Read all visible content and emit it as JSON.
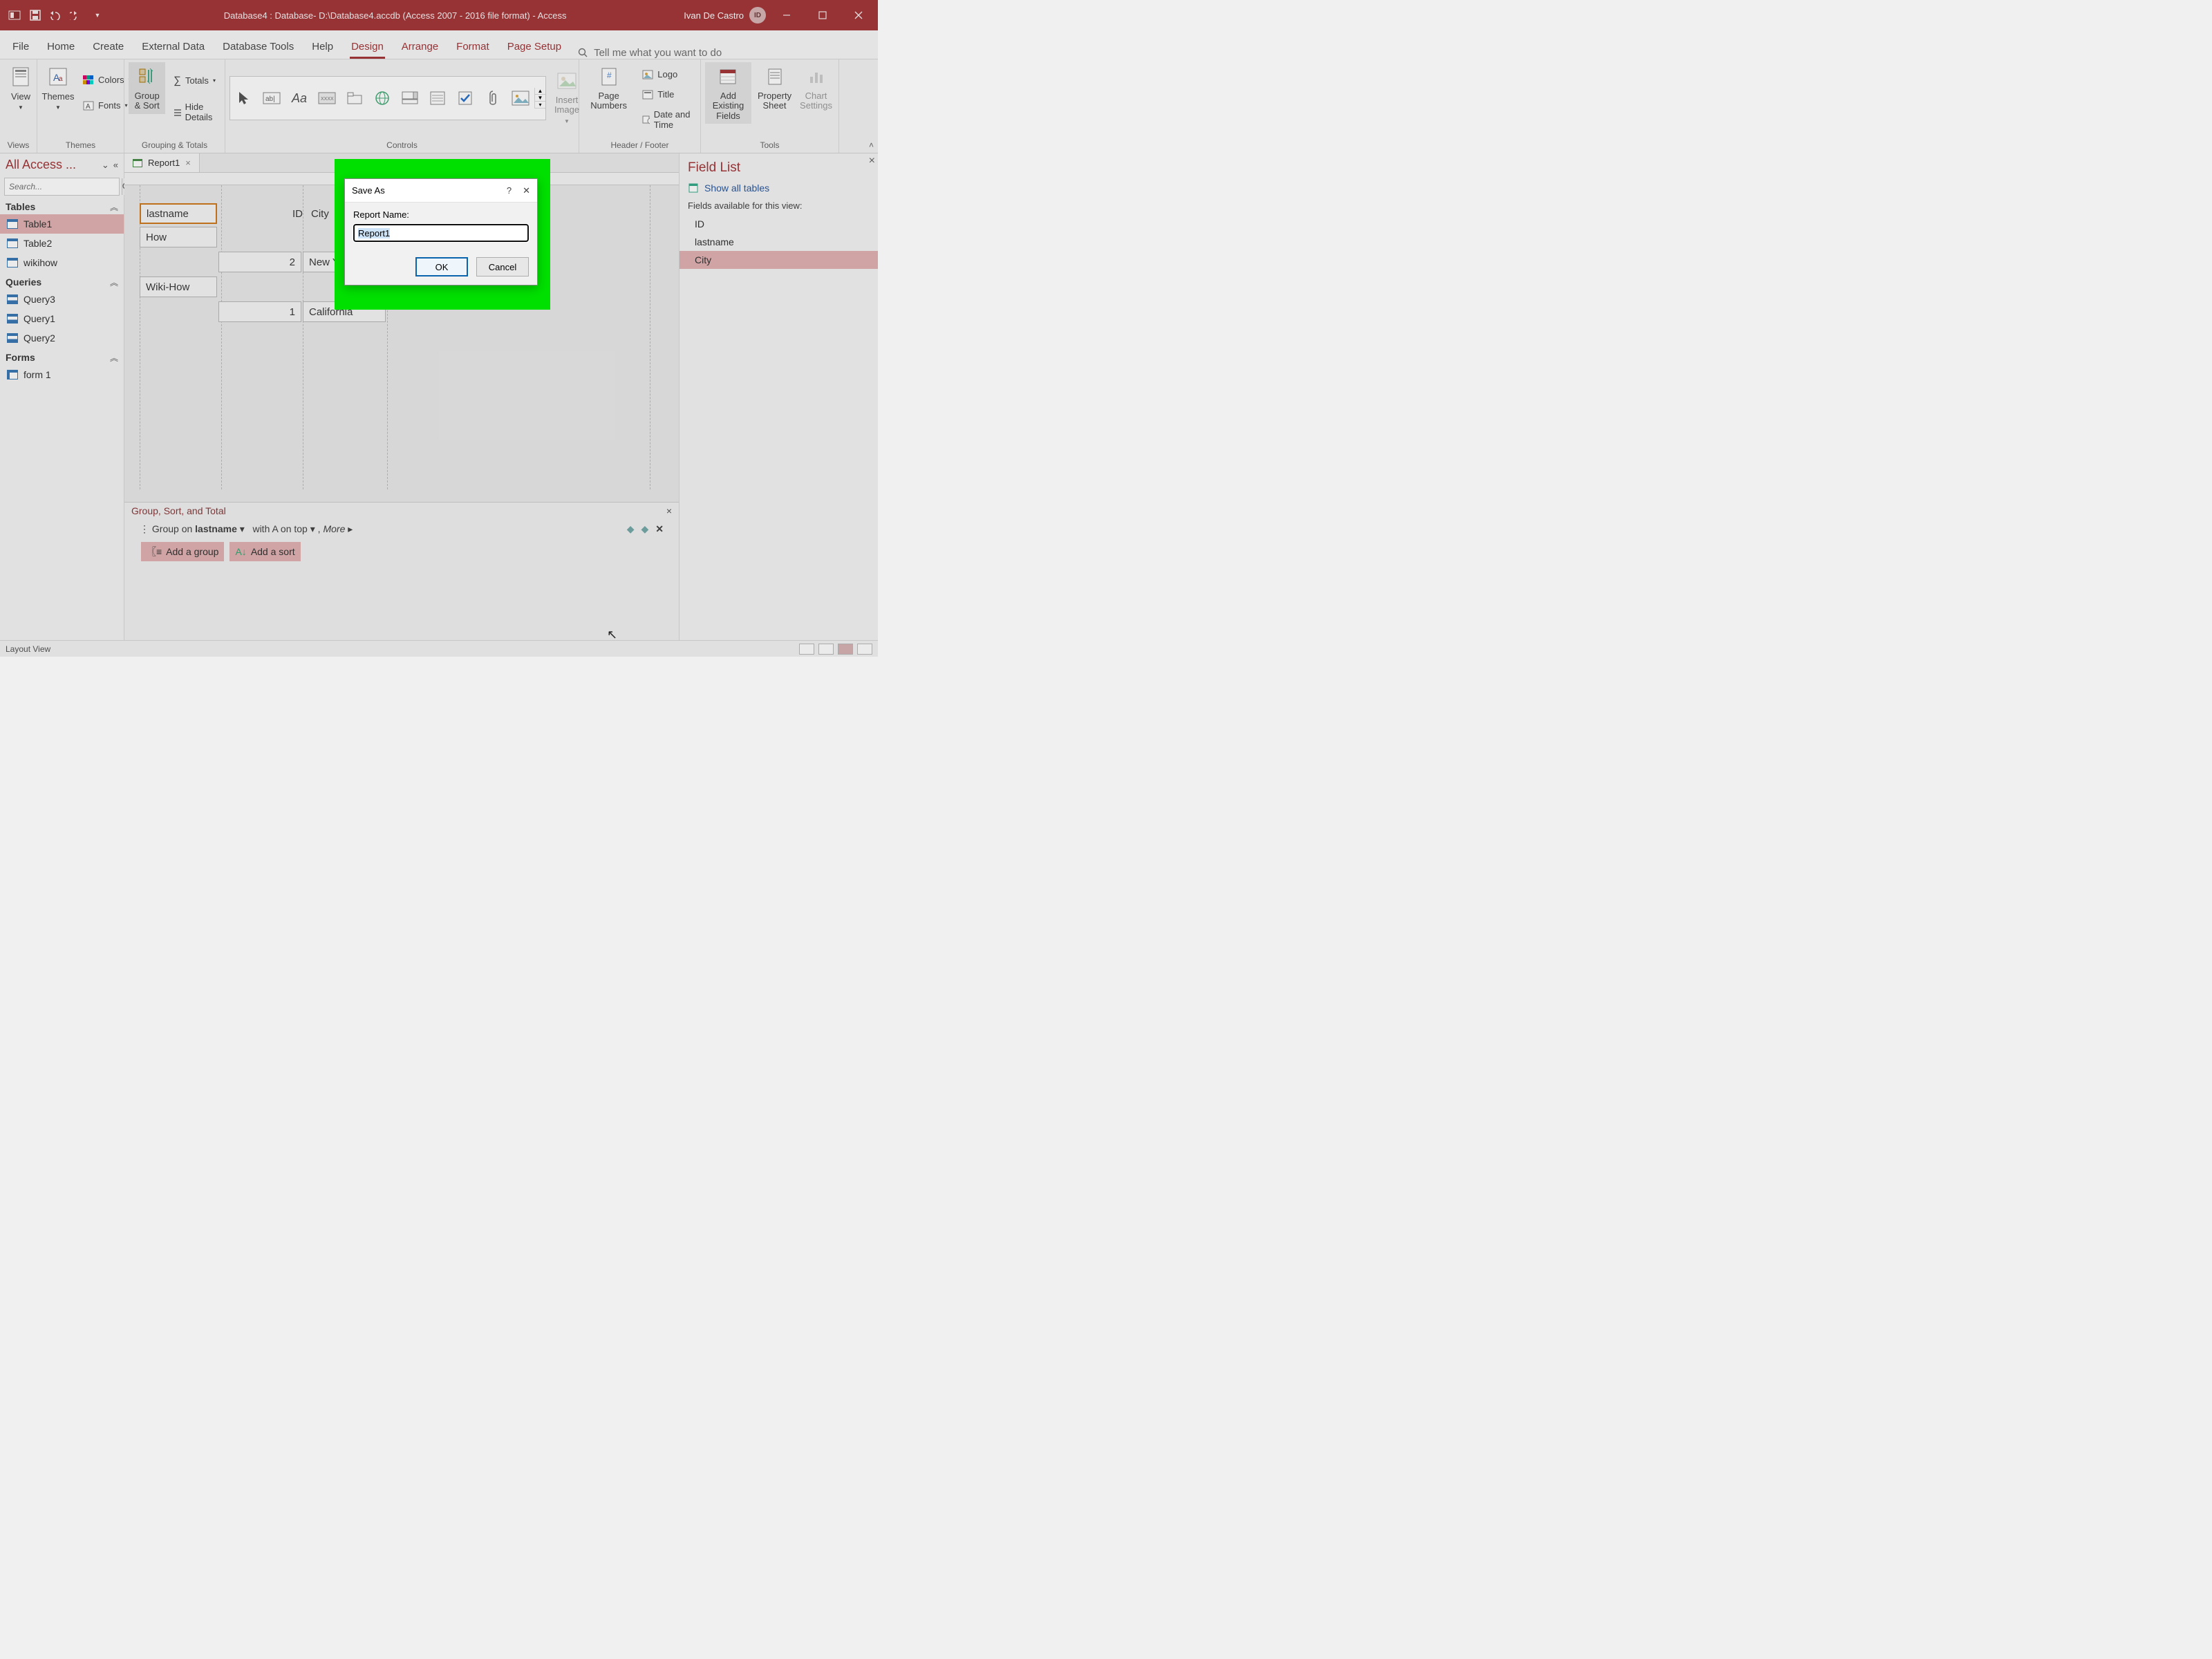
{
  "titlebar": {
    "title": "Database4 : Database- D:\\Database4.accdb (Access 2007 - 2016 file format) -  Access",
    "user_name": "Ivan De Castro",
    "user_initials": "ID"
  },
  "ribbon_tabs": [
    "File",
    "Home",
    "Create",
    "External Data",
    "Database Tools",
    "Help",
    "Design",
    "Arrange",
    "Format",
    "Page Setup"
  ],
  "ribbon_active_tab": "Design",
  "tellme_placeholder": "Tell me what you want to do",
  "ribbon": {
    "views": {
      "view": "View",
      "group": "Views"
    },
    "themes": {
      "themes": "Themes",
      "colors": "Colors",
      "fonts": "Fonts",
      "group": "Themes"
    },
    "grouping": {
      "group_sort": "Group & Sort",
      "totals": "Totals",
      "hide_details": "Hide Details",
      "group": "Grouping & Totals"
    },
    "controls": {
      "insert_image": "Insert Image",
      "group": "Controls"
    },
    "header_footer": {
      "page_numbers": "Page Numbers",
      "logo": "Logo",
      "title": "Title",
      "date_time": "Date and Time",
      "group": "Header / Footer"
    },
    "tools": {
      "add_fields": "Add Existing Fields",
      "property_sheet": "Property Sheet",
      "chart_settings": "Chart Settings",
      "group": "Tools"
    }
  },
  "nav": {
    "header": "All Access ...",
    "search_placeholder": "Search...",
    "sections": {
      "tables": {
        "label": "Tables",
        "items": [
          "Table1",
          "Table2",
          "wikihow"
        ],
        "selected": 0
      },
      "queries": {
        "label": "Queries",
        "items": [
          "Query3",
          "Query1",
          "Query2"
        ]
      },
      "forms": {
        "label": "Forms",
        "items": [
          "form 1"
        ]
      }
    }
  },
  "doc_tab": {
    "label": "Report1"
  },
  "report": {
    "headers": {
      "lastname": "lastname",
      "id": "ID",
      "city": "City"
    },
    "rows": [
      {
        "lastname": "How",
        "id": "2",
        "city": "New York"
      },
      {
        "lastname": "Wiki-How",
        "id": "1",
        "city": "California"
      }
    ]
  },
  "group_panel": {
    "title": "Group, Sort, and Total",
    "group_on": "Group on",
    "group_field": "lastname",
    "with_text": "with A on top",
    "more": "More",
    "add_group": "Add a group",
    "add_sort": "Add a sort"
  },
  "field_list": {
    "title": "Field List",
    "show_all": "Show all tables",
    "available": "Fields available for this view:",
    "fields": [
      "ID",
      "lastname",
      "City"
    ],
    "selected": 2
  },
  "dialog": {
    "title": "Save As",
    "label": "Report Name:",
    "value": "Report1",
    "ok": "OK",
    "cancel": "Cancel"
  },
  "statusbar": {
    "mode": "Layout View"
  }
}
